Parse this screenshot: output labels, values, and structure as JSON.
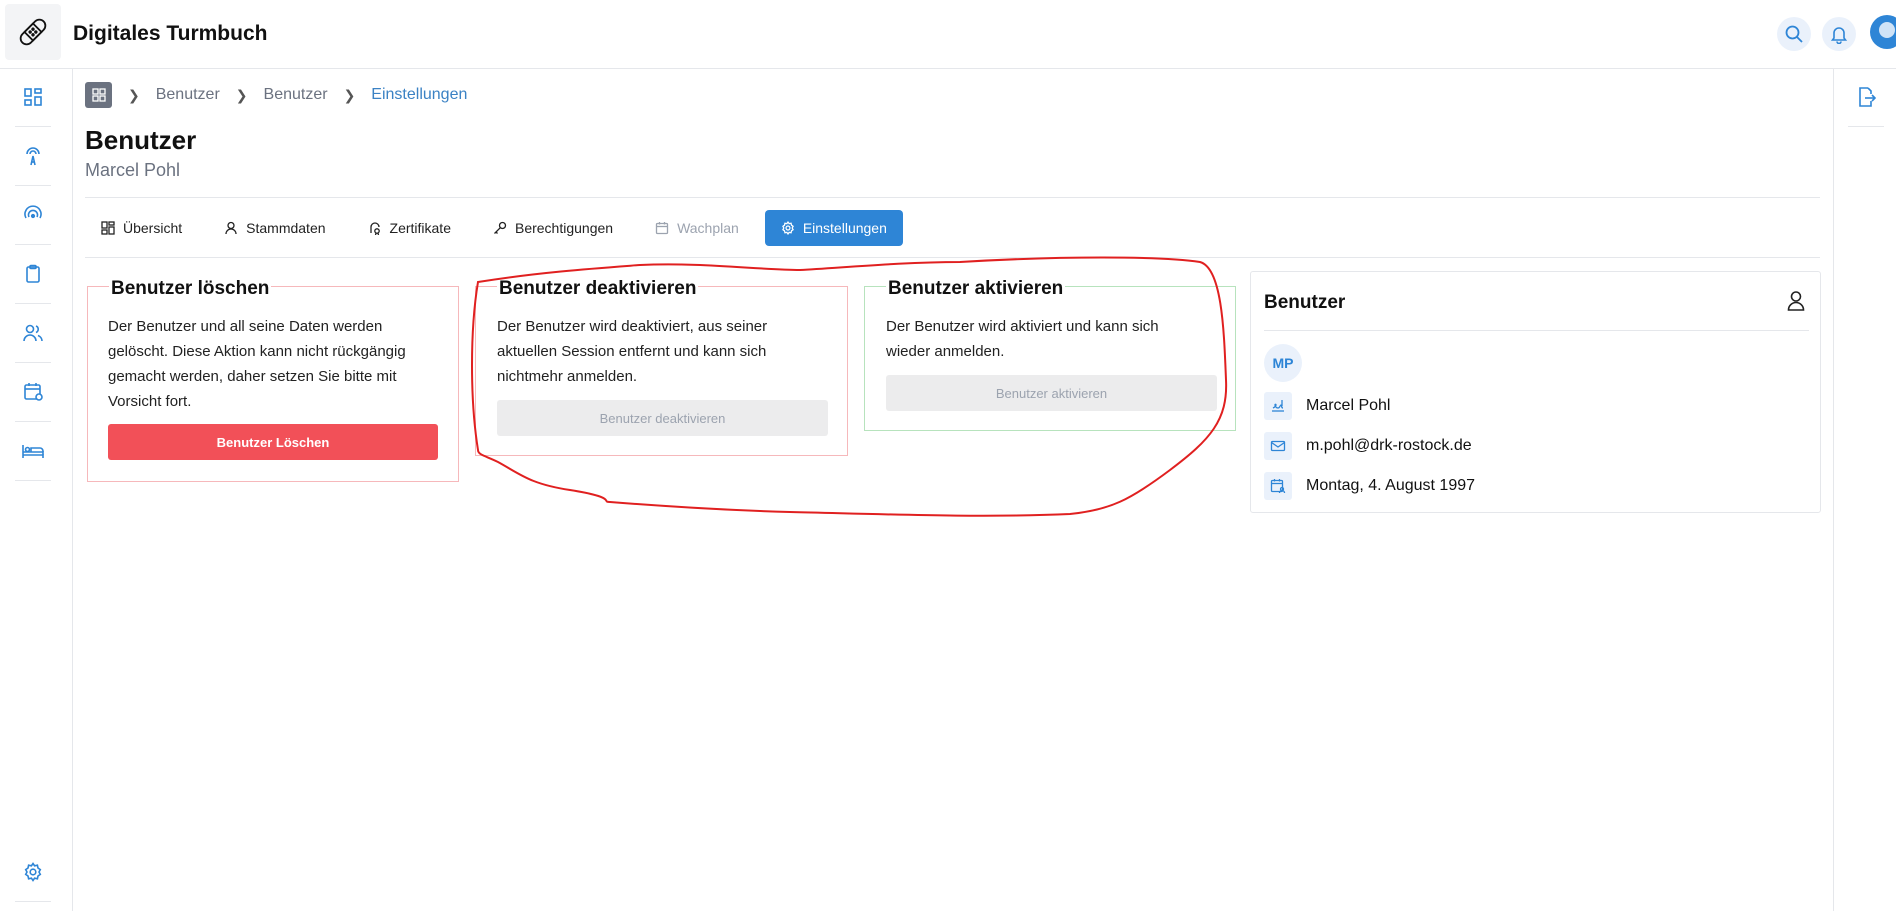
{
  "app": {
    "title": "Digitales Turmbuch"
  },
  "breadcrumb": {
    "items": [
      "Benutzer",
      "Benutzer",
      "Einstellungen"
    ]
  },
  "page": {
    "title": "Benutzer",
    "subtitle": "Marcel Pohl"
  },
  "tabs": [
    {
      "label": "Übersicht",
      "icon": "grid-icon",
      "state": "normal"
    },
    {
      "label": "Stammdaten",
      "icon": "user-icon",
      "state": "normal"
    },
    {
      "label": "Zertifikate",
      "icon": "certificate-icon",
      "state": "normal"
    },
    {
      "label": "Berechtigungen",
      "icon": "key-icon",
      "state": "normal"
    },
    {
      "label": "Wachplan",
      "icon": "calendar-icon",
      "state": "disabled"
    },
    {
      "label": "Einstellungen",
      "icon": "gear-icon",
      "state": "active"
    }
  ],
  "cards": {
    "delete": {
      "title": "Benutzer löschen",
      "text": "Der Benutzer und all seine Daten werden gelöscht. Diese Aktion kann nicht rückgängig gemacht werden, daher setzen Sie bitte mit Vorsicht fort.",
      "button": "Benutzer Löschen",
      "border_color": "#f6b8bb"
    },
    "deactivate": {
      "title": "Benutzer deaktivieren",
      "text": "Der Benutzer wird deaktiviert, aus seiner aktuellen Session entfernt und kann sich nichtmehr anmelden.",
      "button": "Benutzer deaktivieren",
      "border_color": "#f6b8bb"
    },
    "activate": {
      "title": "Benutzer aktivieren",
      "text": "Der Benutzer wird aktiviert und kann sich wieder anmelden.",
      "button": "Benutzer aktivieren",
      "border_color": "#b7e3bd"
    }
  },
  "user_info": {
    "title": "Benutzer",
    "initials": "MP",
    "name": "Marcel Pohl",
    "email": "m.pohl@drk-rostock.de",
    "birthday": "Montag, 4. August 1997"
  },
  "colors": {
    "accent": "#2e85d6",
    "danger": "#f25058",
    "annotation": "#e02020"
  }
}
